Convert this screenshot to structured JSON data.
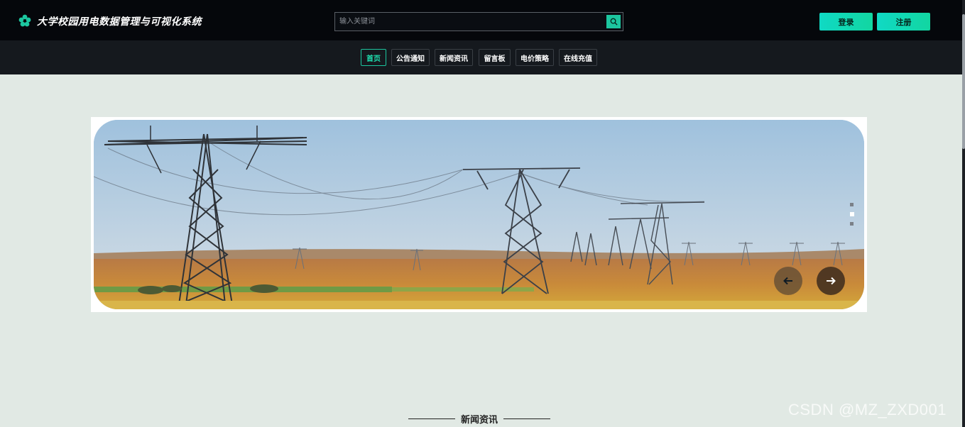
{
  "header": {
    "title": "大学校园用电数据管理与可视化系统",
    "search_placeholder": "输入关键词",
    "login_label": "登录",
    "register_label": "注册"
  },
  "nav": {
    "items": [
      "首页",
      "公告通知",
      "新闻资讯",
      "留言板",
      "电价策略",
      "在线充值"
    ],
    "active_index": 0
  },
  "banner": {
    "slide_count": 3,
    "active_slide": 1
  },
  "news_section": {
    "title": "新闻资讯"
  },
  "watermark": "CSDN @MZ_ZXD001",
  "colors": {
    "accent": "#1cc69f",
    "header_bg": "#05070b",
    "nav_bg": "#15191e",
    "page_bg": "#e1e9e4"
  },
  "icons": {
    "logo": "flower-logo-icon",
    "search": "search-icon",
    "prev": "arrow-left-icon",
    "next": "arrow-right-icon"
  }
}
